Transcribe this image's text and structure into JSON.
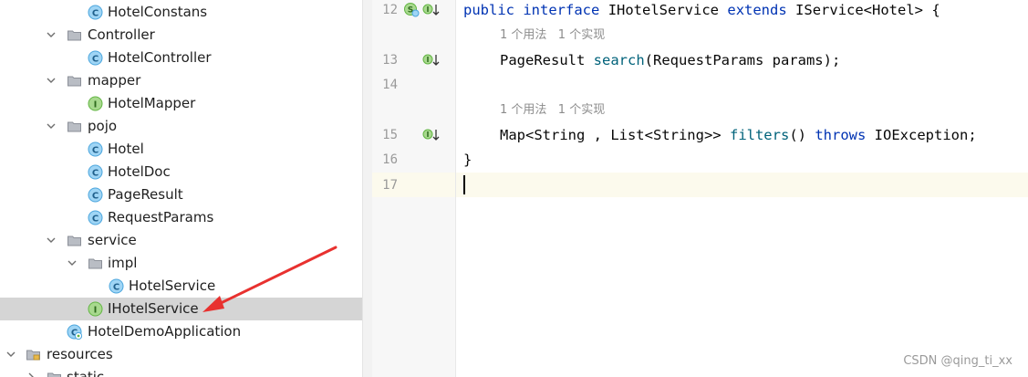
{
  "tree": {
    "items": [
      {
        "label": "HotelConstans",
        "kind": "class"
      },
      {
        "label": "Controller",
        "kind": "folder"
      },
      {
        "label": "HotelController",
        "kind": "class"
      },
      {
        "label": "mapper",
        "kind": "folder"
      },
      {
        "label": "HotelMapper",
        "kind": "interface"
      },
      {
        "label": "pojo",
        "kind": "folder"
      },
      {
        "label": "Hotel",
        "kind": "class"
      },
      {
        "label": "HotelDoc",
        "kind": "class"
      },
      {
        "label": "PageResult",
        "kind": "class"
      },
      {
        "label": "RequestParams",
        "kind": "class"
      },
      {
        "label": "service",
        "kind": "folder"
      },
      {
        "label": "impl",
        "kind": "folder"
      },
      {
        "label": "HotelService",
        "kind": "class"
      },
      {
        "label": "IHotelService",
        "kind": "interface",
        "selected": true
      },
      {
        "label": "HotelDemoApplication",
        "kind": "spring-class"
      },
      {
        "label": "resources",
        "kind": "resources-folder"
      },
      {
        "label": "static",
        "kind": "folder"
      }
    ]
  },
  "editor": {
    "line_numbers": [
      "12",
      "13",
      "14",
      "15",
      "16",
      "17"
    ],
    "hints": [
      "1 个用法   1 个实现",
      "1 个用法   1 个实现"
    ],
    "code": {
      "l12_kw1": "public",
      "l12_kw2": "interface",
      "l12_name": "IHotelService",
      "l12_kw3": "extends",
      "l12_rest": "IService<Hotel> {",
      "l13_type": "PageResult",
      "l13_fn": "search",
      "l13_rest": "(RequestParams params);",
      "l15_type": "Map<String , List<String>>",
      "l15_fn": "filters",
      "l15_paren": "()",
      "l15_kw": "throws",
      "l15_rest": "IOException;",
      "l16": "}"
    }
  },
  "watermark": "CSDN @qing_ti_xx",
  "colors": {
    "keyword": "#0033b3",
    "method": "#00627a",
    "class_icon": "#4aa5dd",
    "interface_icon": "#62b543",
    "selection": "#d5d5d5",
    "arrow": "#e8312f"
  }
}
